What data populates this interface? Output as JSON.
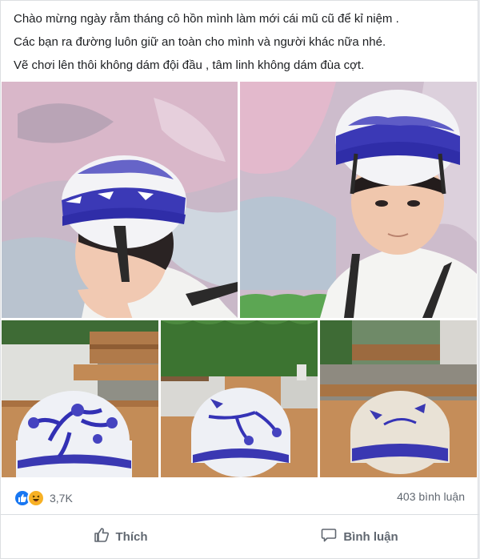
{
  "post": {
    "lines": [
      "Chào mừng ngày rằm tháng cô hồn mình làm mới cái mũ cũ để kỉ niệm .",
      "Các bạn ra đường luôn giữ an toàn cho mình và người khác nữa nhé.",
      "Vẽ chơi lên thôi không dám đội đầu , tâm linh không dám đùa cợt."
    ]
  },
  "photos": [
    {
      "icon": "photo-man-helmet-profile"
    },
    {
      "icon": "photo-man-helmet-front"
    },
    {
      "icon": "photo-helmet-pine-tree"
    },
    {
      "icon": "photo-helmet-bird-branch"
    },
    {
      "icon": "photo-helmet-back"
    }
  ],
  "reactions": {
    "count": "3,7K",
    "icons": [
      "like-reaction-icon",
      "haha-reaction-icon"
    ],
    "colors": {
      "like": "#1877f2",
      "haha": "#f7b125"
    }
  },
  "comments": {
    "label": "403 bình luận"
  },
  "actions": {
    "like_label": "Thích",
    "comment_label": "Bình luận"
  },
  "colors": {
    "text": "#1c1e21",
    "secondary": "#606770",
    "border": "#dadde1"
  }
}
